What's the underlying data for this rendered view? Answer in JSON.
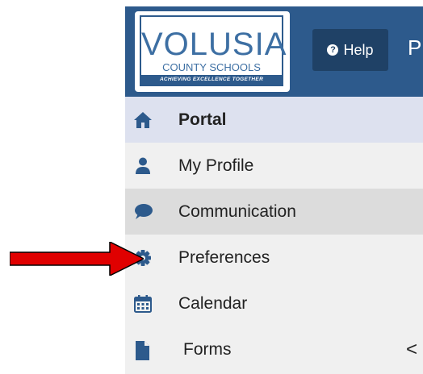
{
  "header": {
    "logo": {
      "word": "VOLUSIA",
      "subtitle": "COUNTY SCHOOLS",
      "tagline": "ACHIEVING EXCELLENCE TOGETHER"
    },
    "help_label": "Help",
    "help_icon": "question-circle-icon",
    "partial_title": "P"
  },
  "sidebar": {
    "items": [
      {
        "label": "Portal",
        "icon": "home-icon",
        "active": true
      },
      {
        "label": "My Profile",
        "icon": "user-icon"
      },
      {
        "label": "Communication",
        "icon": "comment-icon",
        "hover": true
      },
      {
        "label": "Preferences",
        "icon": "gear-icon"
      },
      {
        "label": "Calendar",
        "icon": "calendar-icon"
      },
      {
        "label": "Forms",
        "icon": "file-icon",
        "chevron": "<"
      }
    ]
  },
  "colors": {
    "header_bg": "#2d5a8c",
    "help_bg": "#1f4166",
    "icon": "#2d5a8c",
    "active_bg": "#dde1ef",
    "hover_bg": "#dcdcdc",
    "sidebar_bg": "#f0f0f0",
    "arrow": "#e00000"
  }
}
